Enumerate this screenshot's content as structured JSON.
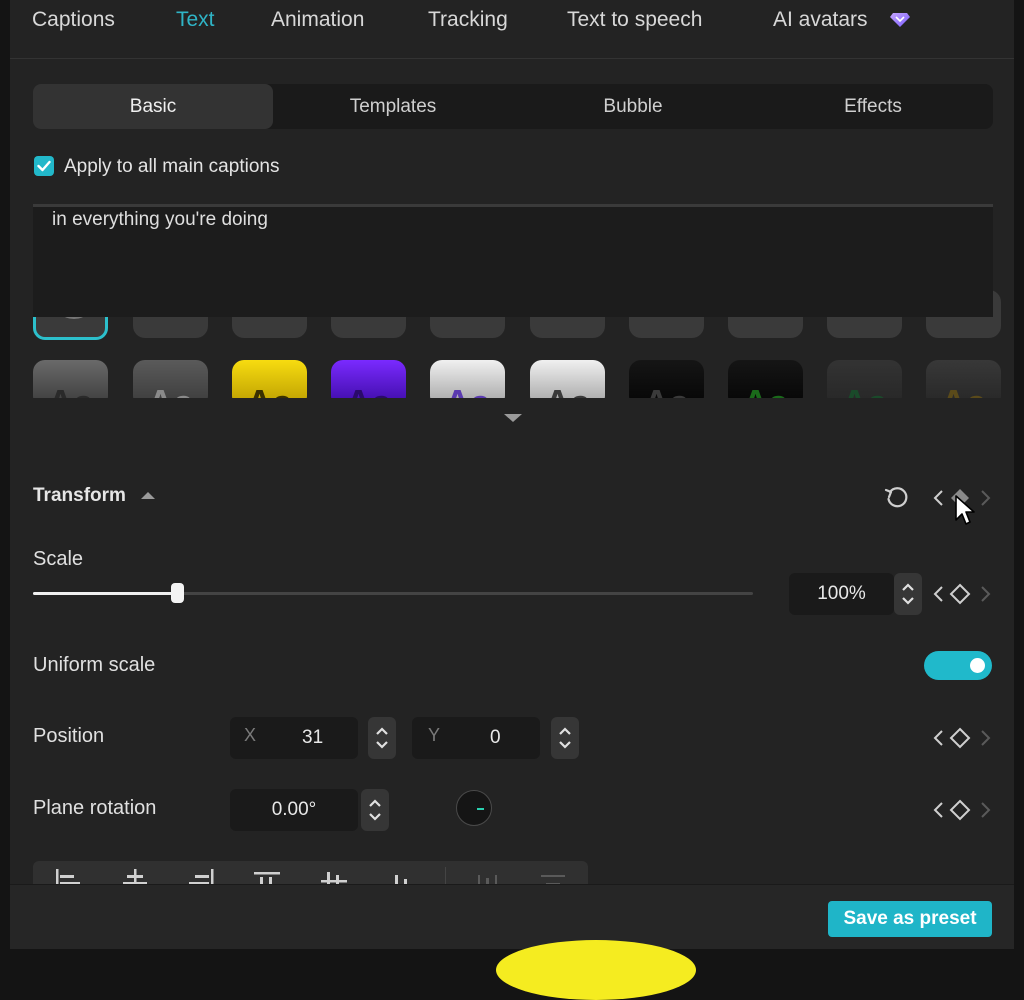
{
  "top_tabs": [
    {
      "label": "Captions",
      "active": false
    },
    {
      "label": "Text",
      "active": true
    },
    {
      "label": "Animation",
      "active": false
    },
    {
      "label": "Tracking",
      "active": false
    },
    {
      "label": "Text to speech",
      "active": false
    },
    {
      "label": "AI avatars",
      "active": false,
      "icon": "diamond-icon"
    }
  ],
  "sub_tabs": [
    {
      "label": "Basic",
      "active": true
    },
    {
      "label": "Templates",
      "active": false
    },
    {
      "label": "Bubble",
      "active": false
    },
    {
      "label": "Effects",
      "active": false
    }
  ],
  "apply_all": {
    "label": "Apply to all main captions",
    "checked": true
  },
  "text_preview": "in everything you're doing",
  "presets": {
    "glyph": "Aa",
    "row1": [
      {
        "style": "selected-ring"
      },
      {
        "fill": "#ffffff",
        "stroke": "#000000"
      },
      {
        "fill": "#ffffff",
        "stroke": "#000000"
      },
      {
        "fill": "#ffffff",
        "stroke": "#000000"
      },
      {
        "fill": "#ffffff",
        "stroke": "#000000"
      },
      {
        "fill": "#e6ff1a",
        "stroke": "#000000"
      },
      {
        "fill": "#ff2a2a",
        "stroke": "#ffffff"
      },
      {
        "fill": "#ff8a1a",
        "stroke": "#ffffff"
      },
      {
        "fill": "#2a8cff",
        "stroke": "#ffffff"
      },
      {
        "fill": "#22cc22",
        "stroke": "#000000"
      }
    ],
    "row2": [
      {
        "bg": "#5a5a5a",
        "fg": "#2a2a2a"
      },
      {
        "bg": "#4a4a4a",
        "fg": "#8a8a8a"
      },
      {
        "bg": "#f2d20a",
        "fg": "#3a3000"
      },
      {
        "bg": "#6a1aff",
        "fg": "#2a0a6a"
      },
      {
        "bg": "#d8d8d8",
        "fg": "#5a3ab0"
      },
      {
        "bg": "#d8d8d8",
        "fg": "#3a3a3a"
      },
      {
        "bg": "#0e0e0e",
        "fg": "#3a3a3a"
      },
      {
        "bg": "#0e0e0e",
        "fg": "#1a6a1a"
      },
      {
        "bg": "#2a2a2a",
        "fg": "#1a4a2a"
      },
      {
        "bg": "#2e2e2e",
        "fg": "#5a4a1a"
      }
    ]
  },
  "transform": {
    "title": "Transform",
    "scale": {
      "label": "Scale",
      "value": "100%",
      "fraction": 0.2
    },
    "uniform_scale": {
      "label": "Uniform scale",
      "on": true
    },
    "position": {
      "label": "Position",
      "x_label": "X",
      "x": "31",
      "y_label": "Y",
      "y": "0"
    },
    "plane_rotation": {
      "label": "Plane rotation",
      "value": "0.00°"
    }
  },
  "footer": {
    "save_label": "Save as preset"
  },
  "colors": {
    "accent": "#22b8ca",
    "panel": "#232323",
    "field": "#1a1a1a"
  }
}
